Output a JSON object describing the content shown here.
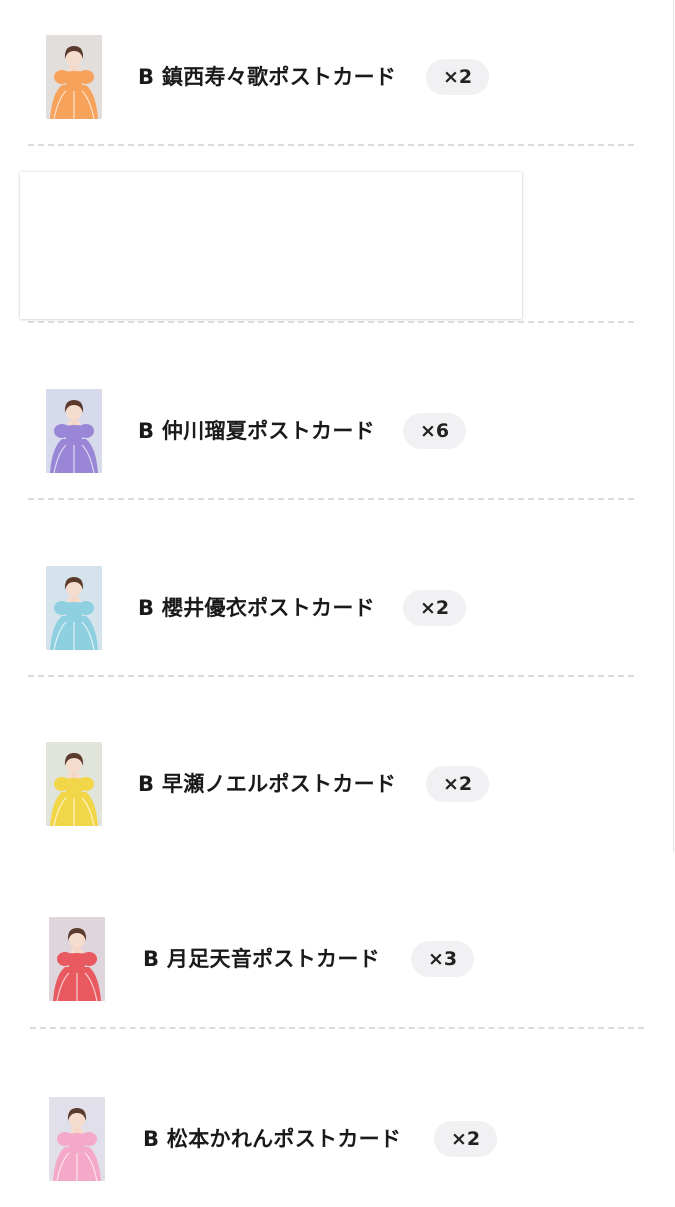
{
  "items": [
    {
      "title": "B 鎮西寿々歌ポストカード",
      "qty": "×2",
      "color": "#f7a25a",
      "icon": "postcard-photo"
    },
    {
      "title": "B 仲川瑠夏ポストカード",
      "qty": "×6",
      "color": "#9a86d6",
      "icon": "postcard-photo"
    },
    {
      "title": "B 櫻井優衣ポストカード",
      "qty": "×2",
      "color": "#8fd0e0",
      "icon": "postcard-photo"
    },
    {
      "title": "B 早瀬ノエルポストカード",
      "qty": "×2",
      "color": "#f2d64a",
      "icon": "postcard-photo"
    },
    {
      "title": "B 月足天音ポストカード",
      "qty": "×3",
      "color": "#e85a5f",
      "icon": "postcard-photo"
    },
    {
      "title": "B 松本かれんポストカード",
      "qty": "×2",
      "color": "#f4a9c8",
      "icon": "postcard-photo"
    }
  ]
}
